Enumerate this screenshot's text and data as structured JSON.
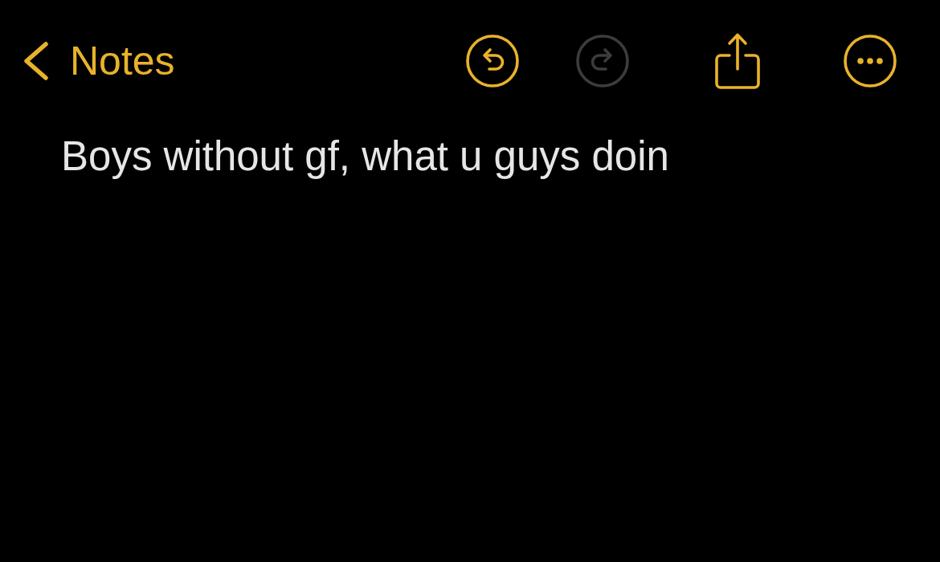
{
  "nav": {
    "back_label": "Notes"
  },
  "toolbar": [
    {
      "kind": "undo",
      "disabled": false
    },
    {
      "kind": "redo",
      "disabled": true
    },
    {
      "kind": "share",
      "disabled": false
    },
    {
      "kind": "more",
      "disabled": false
    }
  ],
  "note": {
    "text": "Boys without gf, what u guys doin"
  }
}
